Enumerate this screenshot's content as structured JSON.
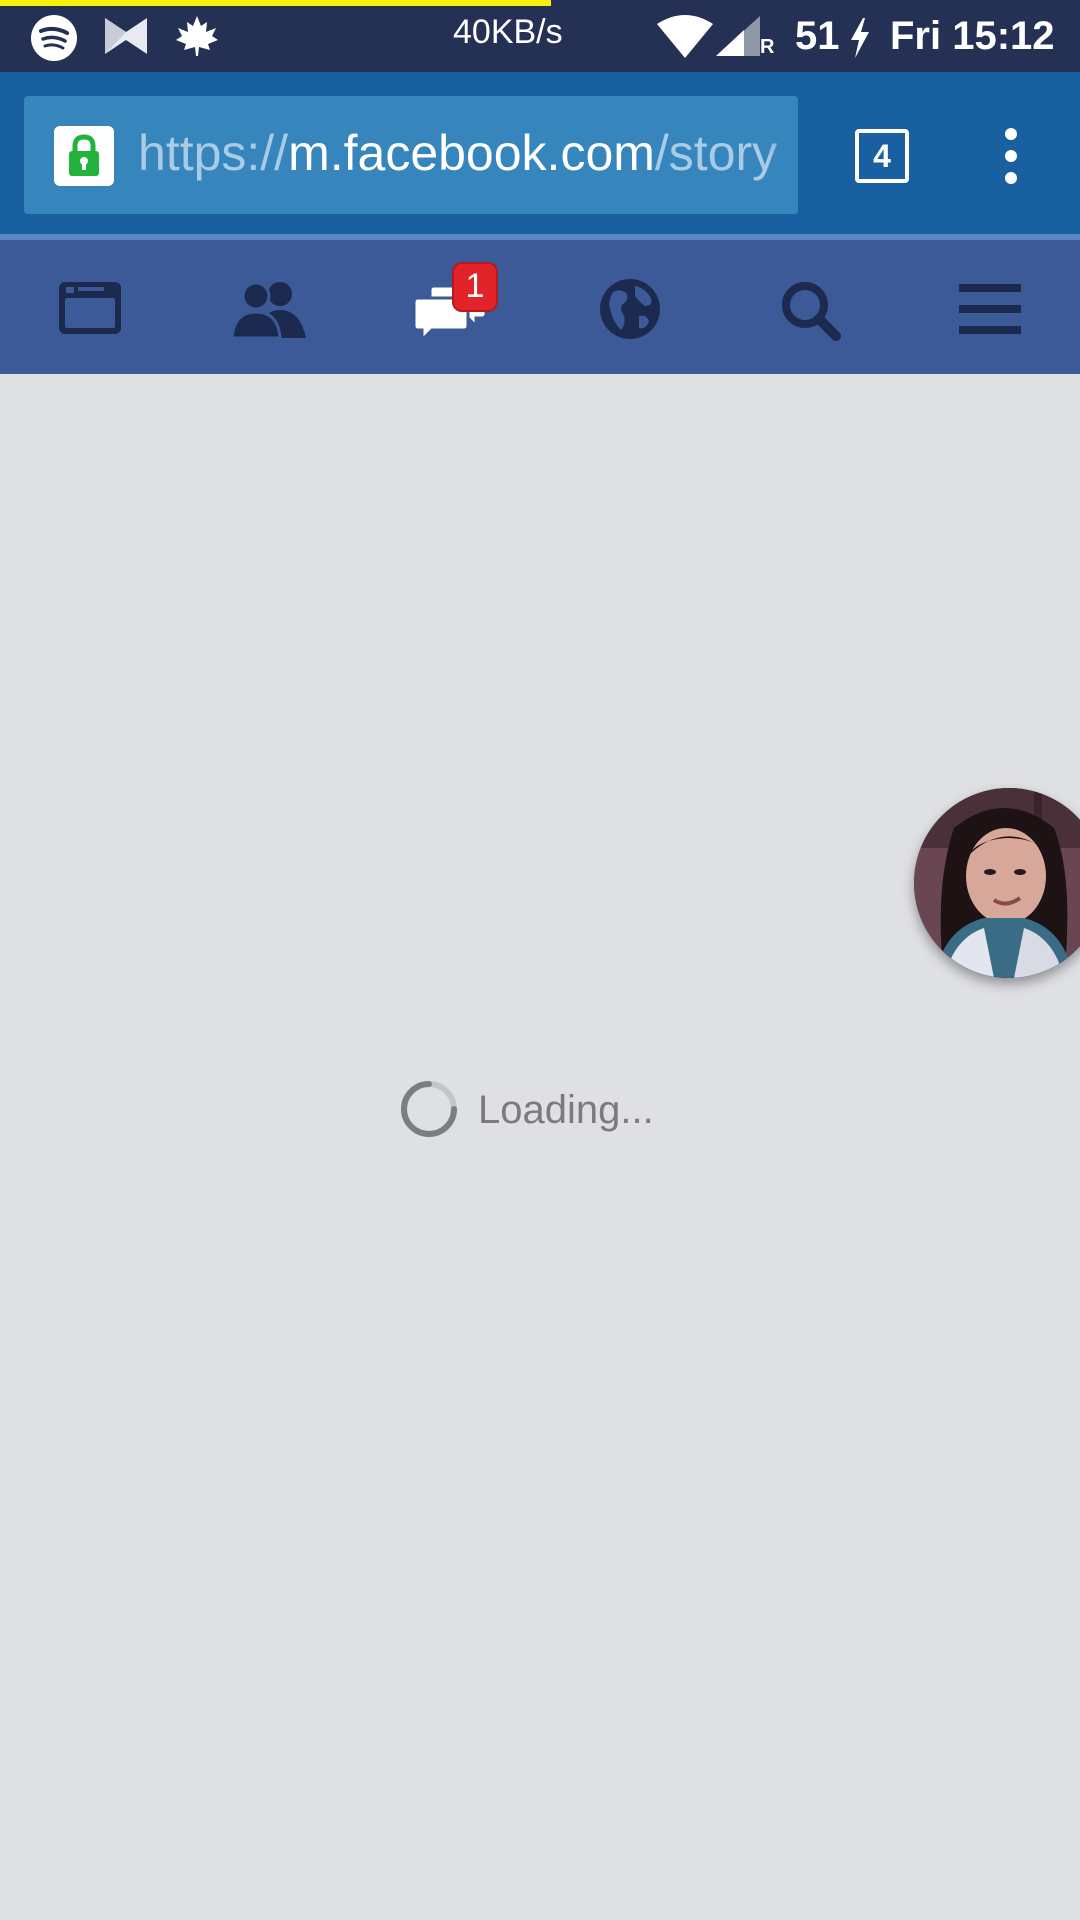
{
  "status_bar": {
    "network_speed": "40KB/s",
    "roaming_indicator": "R",
    "battery_level": "51",
    "clock": "Fri 15:12",
    "page_load_progress": 0.51,
    "icons": [
      "spotify-icon",
      "bowtie-app-icon",
      "maple-leaf-icon",
      "wifi-icon",
      "cellular-signal-icon",
      "charging-bolt-icon"
    ]
  },
  "browser": {
    "url_scheme": "https://",
    "url_host": "m.facebook.com",
    "url_path": "/story",
    "tab_count": "4",
    "icons": [
      "lock-icon",
      "tab-switcher-icon",
      "overflow-menu-icon"
    ]
  },
  "fb_nav": {
    "items": [
      {
        "name": "news-feed",
        "icon": "news-feed-icon"
      },
      {
        "name": "friend-requests",
        "icon": "friends-icon"
      },
      {
        "name": "messages",
        "icon": "messages-icon"
      },
      {
        "name": "notifications",
        "icon": "globe-icon"
      },
      {
        "name": "search",
        "icon": "search-icon"
      },
      {
        "name": "menu",
        "icon": "hamburger-menu-icon"
      }
    ],
    "messages_badge": "1"
  },
  "content": {
    "loading_text": "Loading..."
  },
  "colors": {
    "status_bar": "#243154",
    "browser_bar": "#1860a0",
    "url_field": "#3685bd",
    "fb_nav": "#3c5998",
    "nav_icon": "#1b2a4e",
    "badge": "#e0242a",
    "content_bg": "#dfe0e4",
    "progress": "#f6f20a"
  }
}
